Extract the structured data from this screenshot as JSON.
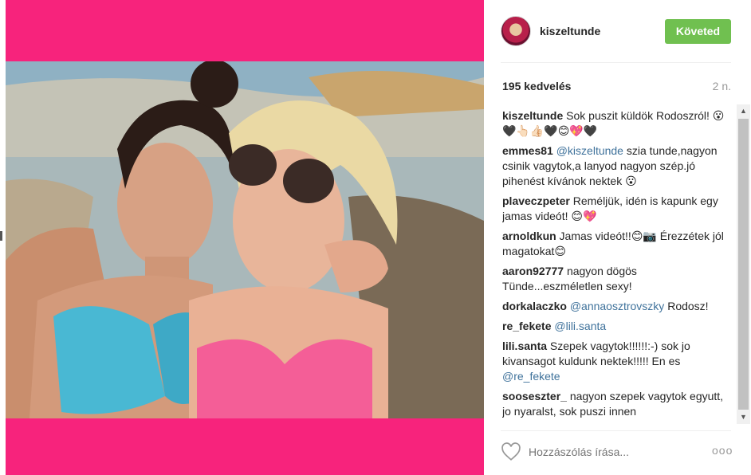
{
  "post": {
    "username": "kiszeltunde",
    "follow_label": "Követed",
    "likes": "195 kedvelés",
    "time": "2 n.",
    "comment_placeholder": "Hozzászólás írása...",
    "more_label": "ooo"
  },
  "comments": [
    {
      "user": "kiszeltunde",
      "text": " Sok puszit küldök Rodoszról! 😮🖤👆🏻👍🏻🖤😊💖🖤"
    },
    {
      "user": "emmes81",
      "mention": "@kiszeltunde",
      "text": " szia tunde,nagyon csinik vagytok,a lanyod nagyon szép.jó pihenést kívánok nektek 😮"
    },
    {
      "user": "plaveczpeter",
      "text": " Reméljük, idén is kapunk egy jamas videót! 😊💖"
    },
    {
      "user": "arnoldkun",
      "text": " Jamas videót!!😊📷 Érezzétek jól magatokat😊"
    },
    {
      "user": "aaron92777",
      "text": " nagyon dögös Tünde...eszméletlen sexy!"
    },
    {
      "user": "dorkalaczko",
      "mention": "@annaosztrovszky",
      "text": " Rodosz!"
    },
    {
      "user": "re_fekete",
      "mention": "@lili.santa",
      "text": ""
    },
    {
      "user": "lili.santa",
      "text": " Szepek vagytok!!!!!!:-) sok jo kivansagot kuldunk nektek!!!!! En es ",
      "mention_after": "@re_fekete"
    },
    {
      "user": "soosеszter_",
      "text": " nagyon szepek vagytok egyutt, jo nyaralst, sok puszi innen"
    }
  ],
  "colors": {
    "photo_border": "#f7237c",
    "follow_button": "#70c050",
    "mention": "#3f729b"
  },
  "icons": {
    "heart": "heart-icon",
    "more": "more-options-icon",
    "scroll_up": "scroll-up-arrow-icon",
    "scroll_down": "scroll-down-arrow-icon"
  }
}
